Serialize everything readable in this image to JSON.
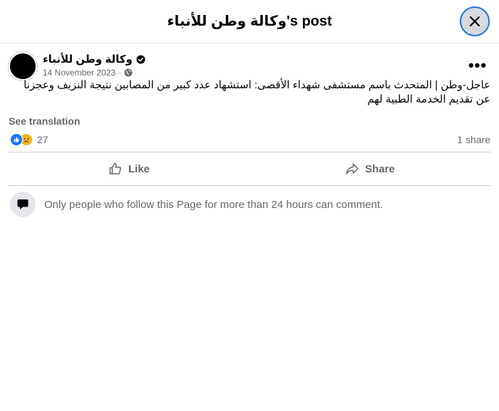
{
  "header": {
    "title": "وكالة وطن للأنباء's post"
  },
  "post": {
    "page_name": "وكالة وطن للأنباء",
    "date": "14 November 2023",
    "separator": "·",
    "audience_icon": "globe-icon",
    "verified_icon": "verified-badge-icon",
    "text": "عاجل-وطن | المتحدث باسم مستشفى شهداء الأقصى: استشهاد عدد كبير من المصابين نتيجة النزيف وعجزنا عن تقديم الخدمة الطبية لهم",
    "see_translation": "See translation",
    "more_label": "•••"
  },
  "stats": {
    "reaction_icons": [
      "like-reaction-icon",
      "sad-reaction-icon"
    ],
    "reaction_count": "27",
    "share_count": "1 share"
  },
  "actions": {
    "like_label": "Like",
    "share_label": "Share"
  },
  "comments": {
    "notice": "Only people who follow this Page for more than 24 hours can comment."
  },
  "colors": {
    "accent": "#1877f2",
    "secondary_text": "#65676b",
    "divider": "#ced0d4"
  }
}
